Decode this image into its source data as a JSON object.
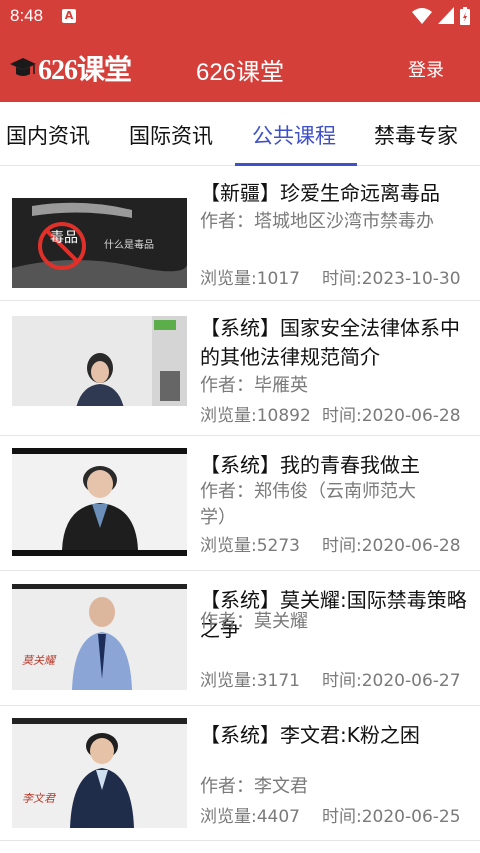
{
  "status_bar": {
    "time": "8:48",
    "notification_letter": "A"
  },
  "app_bar": {
    "logo_text": "626课堂",
    "title": "626课堂",
    "login_label": "登录"
  },
  "tabs": [
    {
      "label": "国内资讯"
    },
    {
      "label": "国际资讯"
    },
    {
      "label": "公共课程"
    },
    {
      "label": "禁毒专家"
    }
  ],
  "active_tab": "公共课程",
  "videos": [
    {
      "title": "【新疆】珍爱生命远离毒品",
      "author": "作者：塔城地区沙湾市禁毒办",
      "views": "浏览量:1017",
      "date": "时间:2023-10-30",
      "thumb_text": "什么是毒品",
      "thumb_big": "毒品"
    },
    {
      "title": "【系统】国家安全法律体系中的其他法律规范简介",
      "author": "作者：毕雁英",
      "views": "浏览量:10892",
      "date": "时间:2020-06-28"
    },
    {
      "title": "【系统】我的青春我做主",
      "author": "作者：郑伟俊（云南师范大学）",
      "views": "浏览量:5273",
      "date": "时间:2020-06-28"
    },
    {
      "title": "【系统】莫关耀:国际禁毒策略之争",
      "author": "作者：莫关耀",
      "views": "浏览量:3171",
      "date": "时间:2020-06-27",
      "thumb_caption": "莫关耀"
    },
    {
      "title": "【系统】李文君:K粉之困",
      "author": "作者：李文君",
      "views": "浏览量:4407",
      "date": "时间:2020-06-25",
      "thumb_caption": "李文君"
    }
  ],
  "colors": {
    "brand_red": "#d43f3a",
    "active_blue": "#3f51c8",
    "meta_gray": "#7a7a7a"
  }
}
